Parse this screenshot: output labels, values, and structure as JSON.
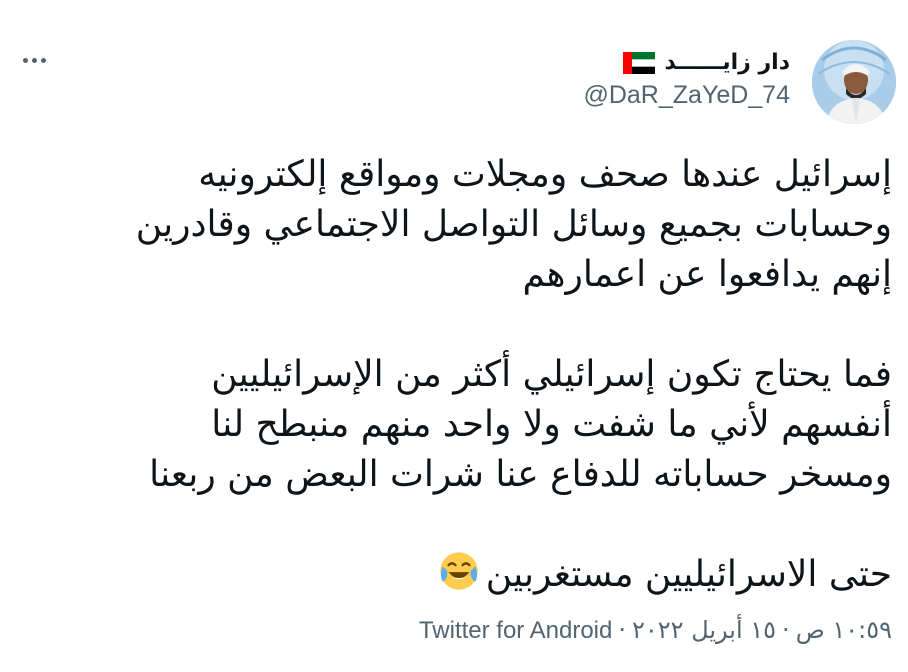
{
  "tweet": {
    "author": {
      "display_name": "دار زايــــــد",
      "handle": "@DaR_ZaYeD_74",
      "flag_icon": "uae-flag-icon"
    },
    "more_icon": "more-options-icon",
    "body": {
      "paragraph_1": [
        "إسرائيل عندها صحف ومجلات ومواقع إلكترونيه",
        "وحسابات بجميع وسائل التواصل الاجتماعي وقادرين",
        "إنهم يدافعوا عن اعمارهم"
      ],
      "paragraph_2": [
        "فما يحتاج تكون إسرائيلي أكثر من الإسرائيليين",
        "أنفسهم لأني ما شفت ولا واحد منهم منبطح لنا",
        "ومسخر حساباته للدفاع عنا شرات البعض من ربعنا"
      ],
      "paragraph_3": "حتى الاسرائيليين مستغربين",
      "emoji_icon": "face-with-tears-of-joy-icon"
    },
    "meta": {
      "time": "١٠:٥٩ ص",
      "date": "١٥ أبريل ٢٠٢٢",
      "separator": "·",
      "source": "Twitter for Android"
    },
    "colors": {
      "text_primary": "#0f1419",
      "text_secondary": "#536471",
      "flag_green": "#00732f",
      "flag_red": "#ff0000",
      "flag_black": "#000000",
      "emoji_yellow": "#ffcc4d",
      "emoji_tear": "#5dadec"
    }
  }
}
